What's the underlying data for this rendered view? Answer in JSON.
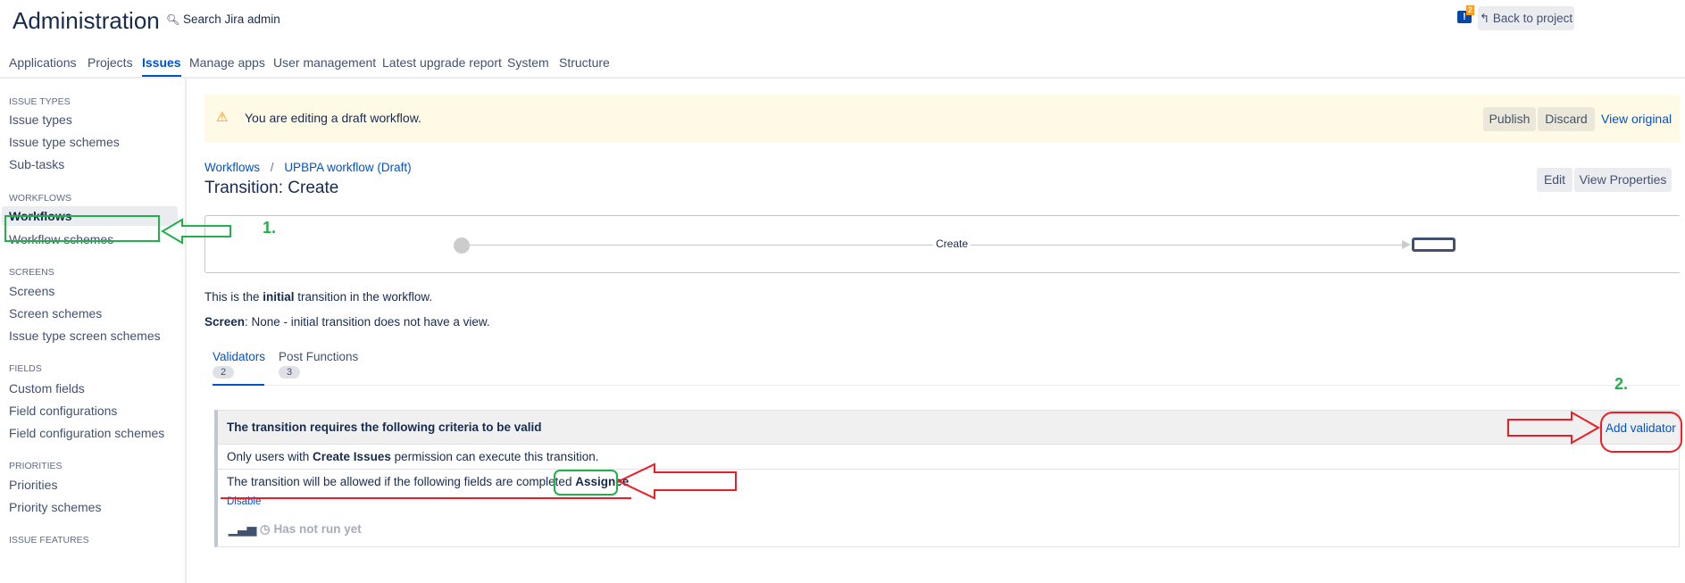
{
  "header": {
    "title": "Administration",
    "search_placeholder": "Search Jira admin",
    "notification_count": "2",
    "back_label": "Back to project"
  },
  "nav": [
    "Applications",
    "Projects",
    "Issues",
    "Manage apps",
    "User management",
    "Latest upgrade report",
    "System",
    "Structure"
  ],
  "sidebar": {
    "sections": [
      {
        "title": "ISSUE TYPES",
        "items": [
          "Issue types",
          "Issue type schemes",
          "Sub-tasks"
        ]
      },
      {
        "title": "WORKFLOWS",
        "items": [
          "Workflows",
          "Workflow schemes"
        ]
      },
      {
        "title": "SCREENS",
        "items": [
          "Screens",
          "Screen schemes",
          "Issue type screen schemes"
        ]
      },
      {
        "title": "FIELDS",
        "items": [
          "Custom fields",
          "Field configurations",
          "Field configuration schemes"
        ]
      },
      {
        "title": "PRIORITIES",
        "items": [
          "Priorities",
          "Priority schemes"
        ]
      },
      {
        "title": "ISSUE FEATURES",
        "items": []
      }
    ]
  },
  "banner": {
    "text": "You are editing a draft workflow.",
    "publish": "Publish",
    "discard": "Discard",
    "view_original": "View original"
  },
  "breadcrumb": {
    "root": "Workflows",
    "sep": "/",
    "current": "UPBPA workflow (Draft)"
  },
  "page_title": "Transition: Create",
  "actions": {
    "edit": "Edit",
    "view_properties": "View Properties"
  },
  "diagram": {
    "transition_label": "Create"
  },
  "info": {
    "l1_a": "This is the ",
    "l1_b": "initial",
    "l1_c": " transition in the workflow.",
    "l2_a": "Screen",
    "l2_b": ": None - initial transition does not have a view."
  },
  "tabs": [
    {
      "label": "Validators",
      "count": "2"
    },
    {
      "label": "Post Functions",
      "count": "3"
    }
  ],
  "panel": {
    "header": "The transition requires the following criteria to be valid",
    "add_validator": "Add validator",
    "row1_a": "Only users with ",
    "row1_b": "Create Issues",
    "row1_c": " permission can execute this transition.",
    "row2_a": "The transition will be allowed if the following fields are completed ",
    "row2_b": "Assignee",
    "disable": "Disable",
    "status": "Has not run yet"
  },
  "annotations": {
    "step1": "1.",
    "step2": "2."
  },
  "colors": {
    "annotation_green": "#22b04b",
    "annotation_red": "#ee1c24",
    "link": "#0052cc",
    "banner": "#fffae6"
  }
}
